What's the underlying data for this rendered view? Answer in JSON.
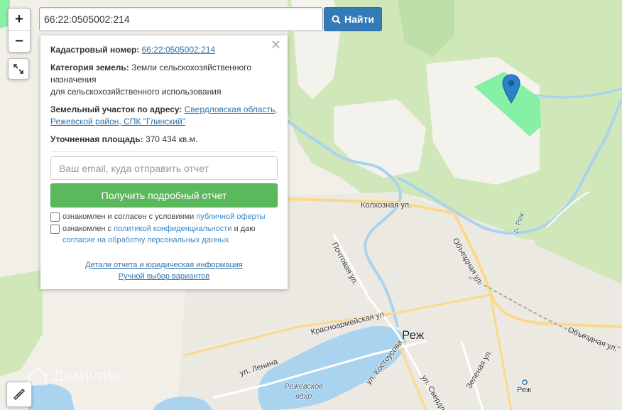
{
  "search": {
    "value": "66:22:0505002:214",
    "button_label": "Найти",
    "button_icon": "search-icon"
  },
  "zoom": {
    "in_label": "+",
    "out_label": "−"
  },
  "controls": {
    "fullscreen_icon": "expand-icon",
    "ruler_icon": "ruler-icon"
  },
  "info": {
    "close_label": "✕",
    "cadastral_label": "Кадастровый номер:",
    "cadastral_value": "66:22:0505002:214",
    "category_label": "Категория земель:",
    "category_value": "Земли сельскохозяйственного назначения",
    "category_value_2": "для сельскохозяйственного использования",
    "address_label": "Земельный участок по адресу:",
    "address_value": "Свердловская область, Режевской район, СПК \"Глинский\"",
    "area_label": "Уточненная площадь:",
    "area_value": "370 434 кв.м.",
    "email_placeholder": "Ваш email, куда отправить отчет",
    "report_button": "Получить подробный отчет",
    "consent1_text": "ознакомлен и согласен с условиями",
    "consent1_link": "публичной оферты",
    "consent2_prefix": "ознакомлен с",
    "consent2_link1": "политикой конфиденциальности",
    "consent2_mid": "и даю",
    "consent2_link2": "согласие на обработку персональных данных",
    "details_link": "Детали отчета и юридическая информация",
    "manual_link": "Ручной выбор вариантов"
  },
  "map_labels": {
    "kolkhoznaya": "Колхозная ул.",
    "pochtovaya": "Почтовая ул.",
    "obezdnaya1": "Объездная ул.",
    "obezdnaya2": "Объездная ул.",
    "krasnoarmeyskaya": "Красноармейская ул.",
    "city": "Реж",
    "lenina": "ул. Ленина",
    "kostousova": "ул. Костоусова",
    "sverdlova": "ул. Свердлова",
    "zelenaya": "Зеленая ул.",
    "station": "Реж",
    "reservoir_1": "Режевское",
    "reservoir_2": "вдхр.",
    "river": "р. Реж"
  },
  "watermark": "Домклик",
  "colors": {
    "parcel": "#7ff0a0",
    "pin": "#2b82cb",
    "search_button": "#337ab7",
    "report_button": "#5cb85c",
    "forest": "#cde6b8",
    "water": "#a9d3ef",
    "road": "#fbd98a"
  }
}
